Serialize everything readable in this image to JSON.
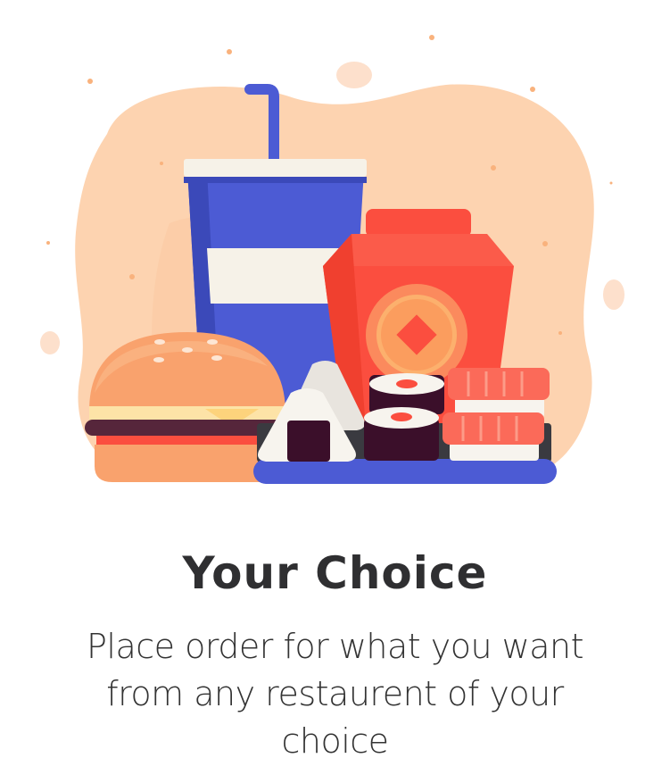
{
  "onboarding": {
    "title": "Your Choice",
    "description": "Place order for what you want from any restaurent of your choice"
  },
  "illustration": {
    "subject": "fast-food-illustration",
    "items": [
      "drink-cup-icon",
      "burger-icon",
      "takeout-box-icon",
      "onigiri-icon",
      "sushi-roll-icon",
      "nigiri-icon",
      "serving-tray-icon"
    ],
    "colors": {
      "blob": "#fdd3b0",
      "cup": "#4c5bd4",
      "box": "#fb4e3f",
      "burger": "#f9a26d",
      "tray": "#4c5bd4"
    }
  }
}
